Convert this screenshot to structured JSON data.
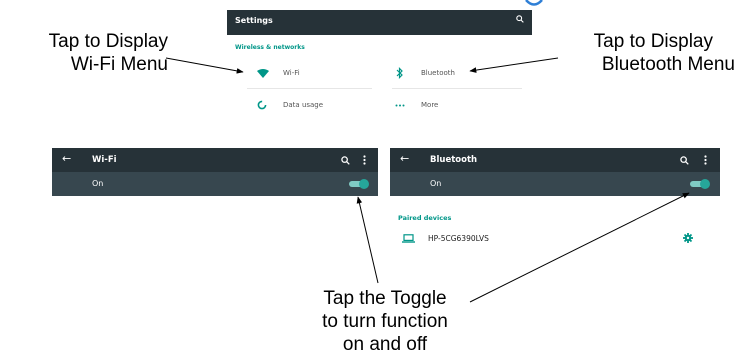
{
  "callouts": {
    "wifi_line1": "Tap to Display",
    "wifi_line2": "Wi-Fi Menu",
    "bt_line1": "Tap to Display",
    "bt_line2": "Bluetooth Menu",
    "toggle_line1": "Tap the Toggle",
    "toggle_line2": "to turn function",
    "toggle_line3": "on and off"
  },
  "settings": {
    "title": "Settings",
    "section": "Wireless & networks",
    "items": [
      {
        "label": "Wi-Fi",
        "icon": "wifi-icon"
      },
      {
        "label": "Bluetooth",
        "icon": "bluetooth-icon"
      },
      {
        "label": "Data usage",
        "icon": "data-usage-icon"
      },
      {
        "label": "More",
        "icon": "more-icon"
      }
    ]
  },
  "wifi_screen": {
    "title": "Wi-Fi",
    "status": "On",
    "toggle_on": true
  },
  "bluetooth_screen": {
    "title": "Bluetooth",
    "status": "On",
    "toggle_on": true,
    "paired_header": "Paired devices",
    "device_name": "HP-5CG6390LVS"
  },
  "colors": {
    "toolbar": "#263238",
    "subbar": "#37474f",
    "accent": "#009688"
  }
}
